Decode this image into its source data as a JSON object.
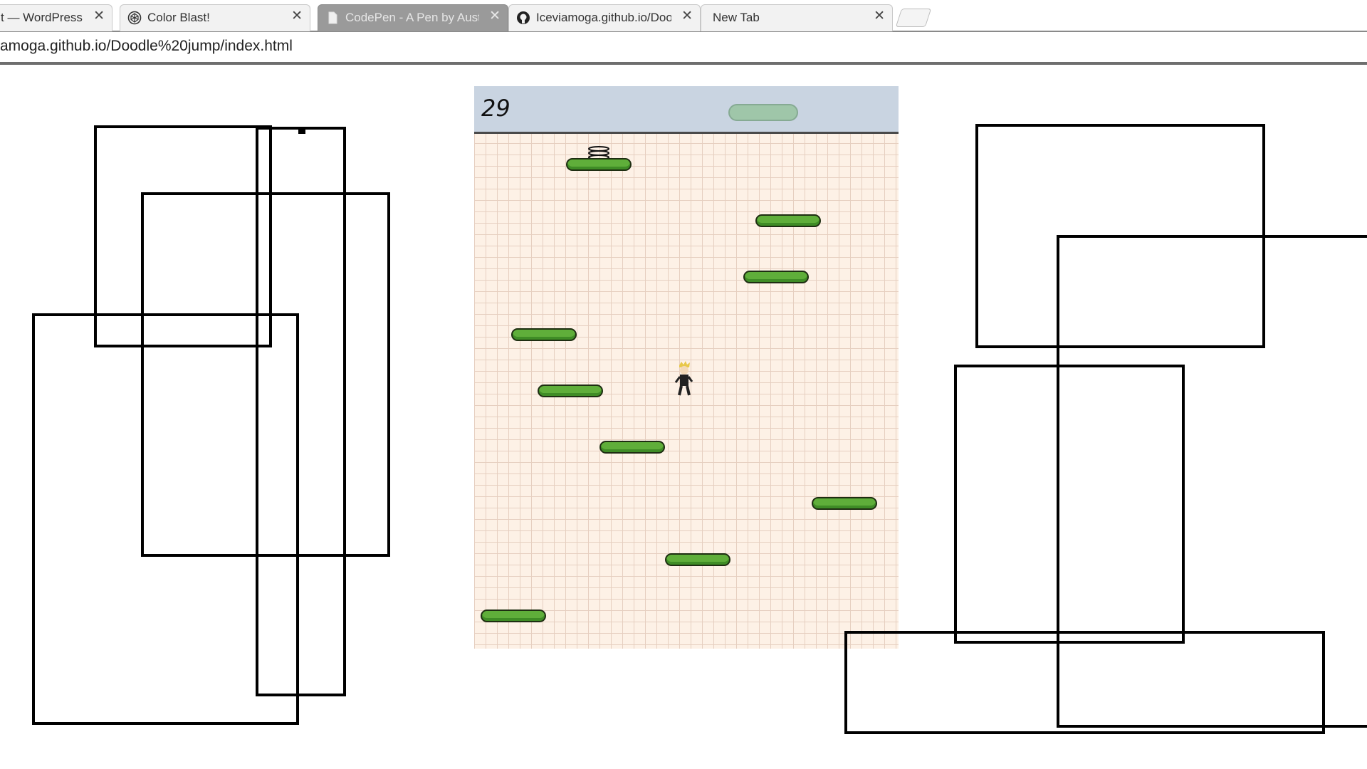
{
  "tabs": [
    {
      "label": "t — WordPress.c",
      "icon": "wordpress-icon",
      "active": false
    },
    {
      "label": "Color Blast!",
      "icon": "codepen-icon",
      "active": false
    },
    {
      "label": "CodePen - A Pen by Aust",
      "icon": "page-icon",
      "active": true
    },
    {
      "label": "Iceviamoga.github.io/Doo",
      "icon": "github-icon",
      "active": false
    },
    {
      "label": "New Tab",
      "icon": "",
      "active": false
    }
  ],
  "address_bar": {
    "url": "amoga.github.io/Doodle%20jump/index.html"
  },
  "game": {
    "score": "29",
    "colors": {
      "paper": "#fdf1e6",
      "grid": "#e6cfc0",
      "hud": "#c9d4e1",
      "platform": "#5fae3a"
    }
  }
}
